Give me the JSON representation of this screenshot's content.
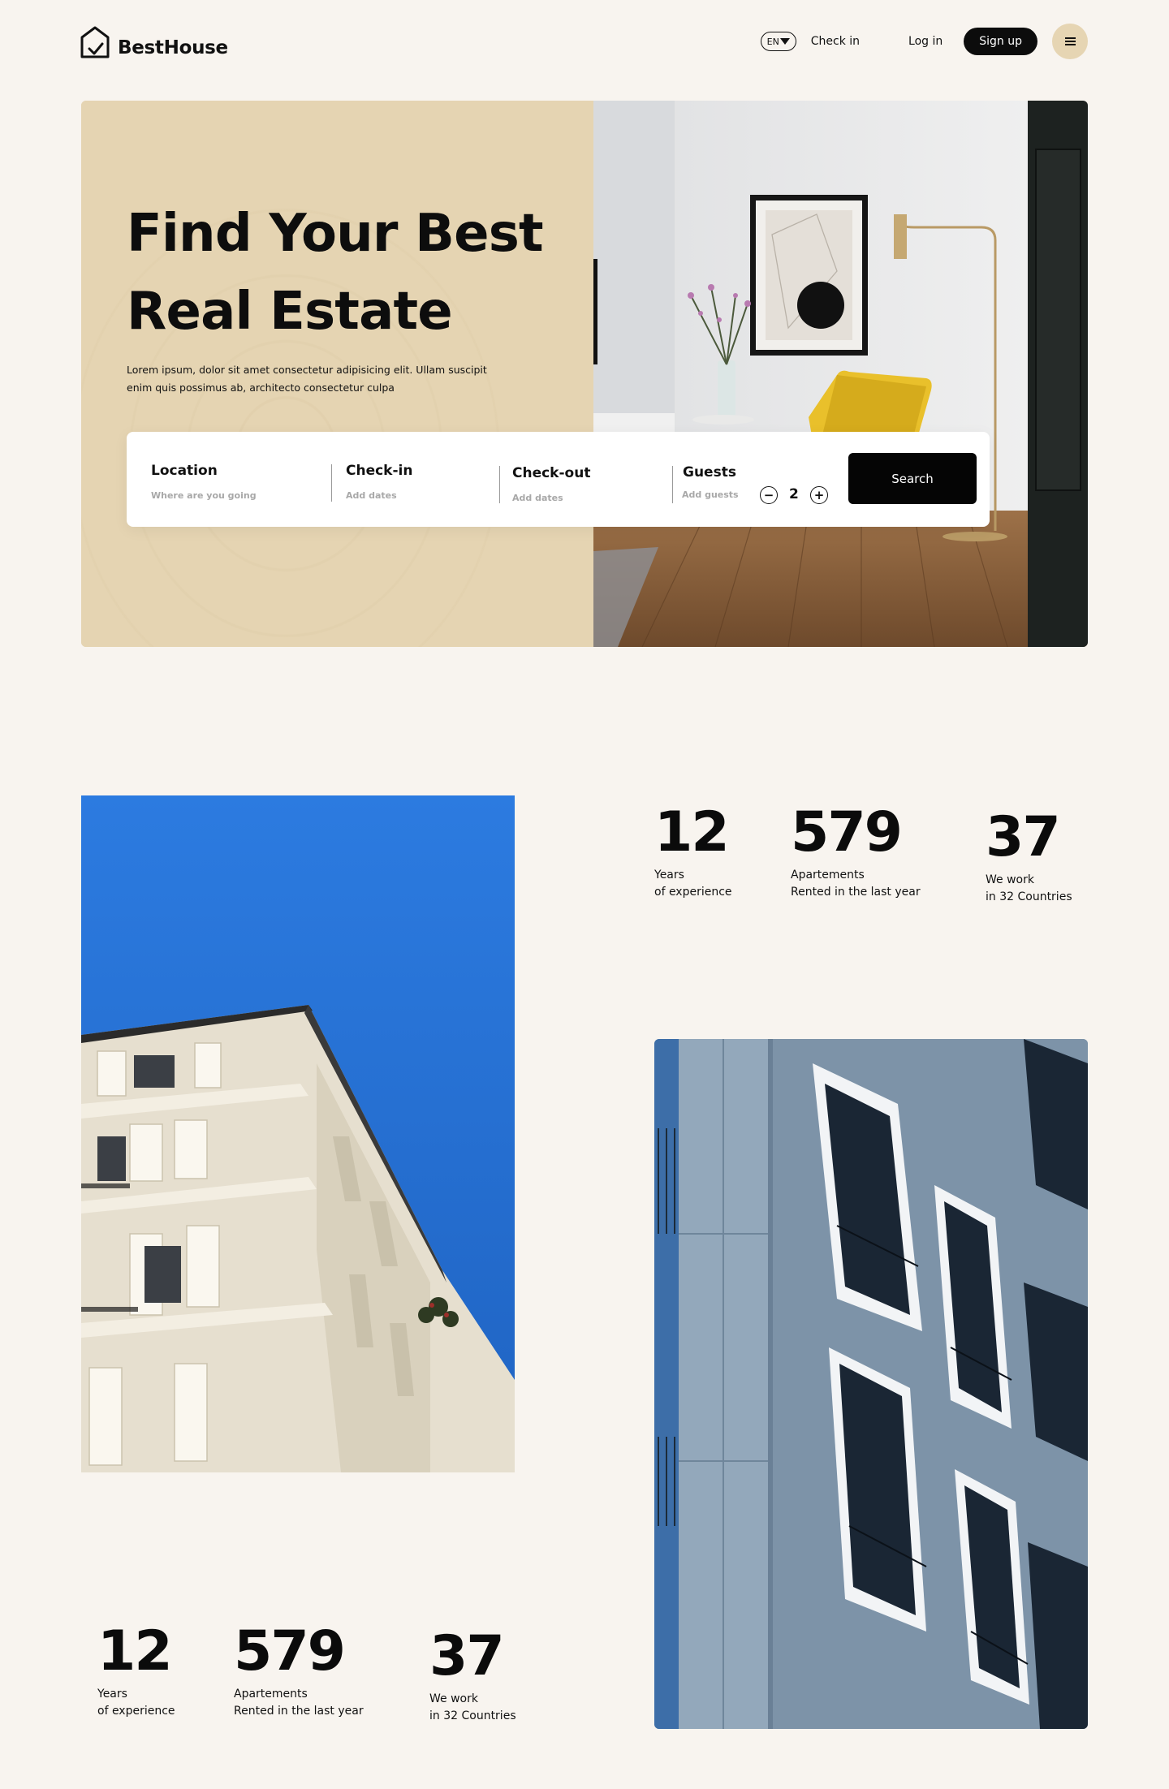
{
  "brand": {
    "name": "BestHouse"
  },
  "nav": {
    "language": "EN",
    "check_in": "Check in",
    "log_in": "Log in",
    "sign_up": "Sign up",
    "menu_icon": "hamburger-menu-icon"
  },
  "hero": {
    "title_line1": "Find Your Best",
    "title_line2": "Real Estate",
    "description": "Lorem ipsum, dolor sit amet consectetur adipisicing elit. Ullam suscipit enim quis possimus ab, architecto consectetur culpa"
  },
  "search": {
    "location": {
      "label": "Location",
      "placeholder": "Where are you going"
    },
    "check_in": {
      "label": "Check-in",
      "placeholder": "Add dates"
    },
    "check_out": {
      "label": "Check-out",
      "placeholder": "Add dates"
    },
    "guests": {
      "label": "Guests",
      "placeholder": "Add guests",
      "value": "2"
    },
    "button": "Search"
  },
  "stats_top": [
    {
      "number": "12",
      "line1": "Years",
      "line2": "of experience"
    },
    {
      "number": "579",
      "line1": "Apartements",
      "line2": "Rented in the last year"
    },
    {
      "number": "37",
      "line1": "We work",
      "line2": "in 32 Countries"
    }
  ],
  "stats_bottom": [
    {
      "number": "12",
      "line1": "Years",
      "line2": "of experience"
    },
    {
      "number": "579",
      "line1": "Apartements",
      "line2": "Rented in the last year"
    },
    {
      "number": "37",
      "line1": "We work",
      "line2": "in 32 Countries"
    }
  ],
  "colors": {
    "background": "#f8f4ef",
    "beige": "#e5d4b2",
    "accent_dark": "#0c0c0c",
    "sky_blue": "#2a78d6"
  }
}
